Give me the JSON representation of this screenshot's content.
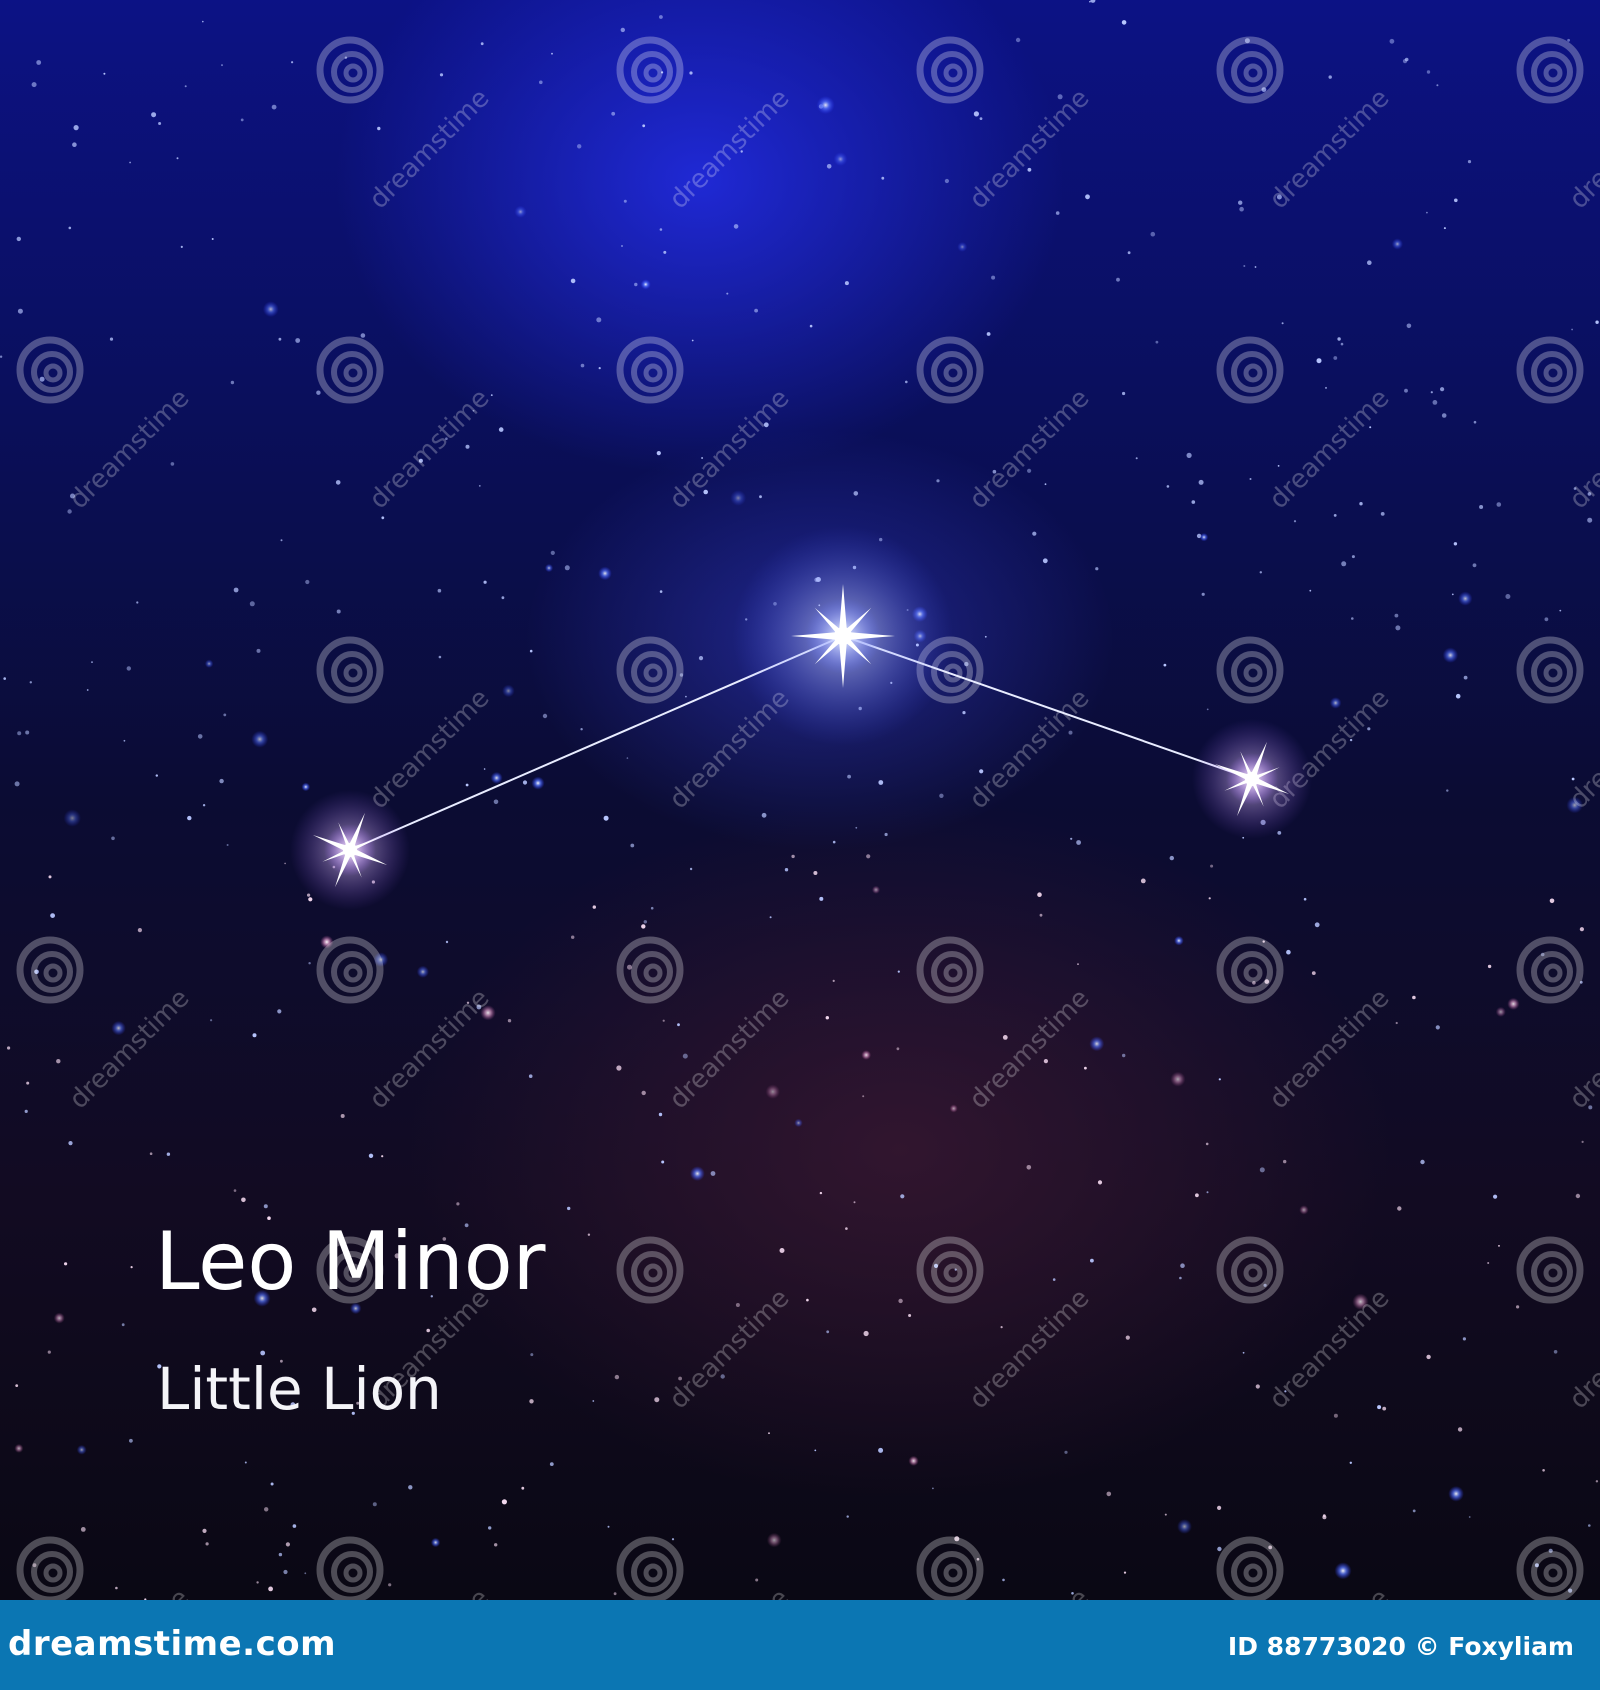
{
  "constellation": {
    "name": "Leo Minor",
    "common_name": "Little Lion"
  },
  "watermark": {
    "text": "dreamstime"
  },
  "footer": {
    "site": "dreamstime.com",
    "id_label": "ID 88773020",
    "author_label": "© Foxyliam"
  },
  "colors": {
    "sky_top": "#0c1285",
    "sky_bottom": "#0a0814",
    "footer_bar": "#0b76b3",
    "star_glow": "#c9d3ff"
  }
}
